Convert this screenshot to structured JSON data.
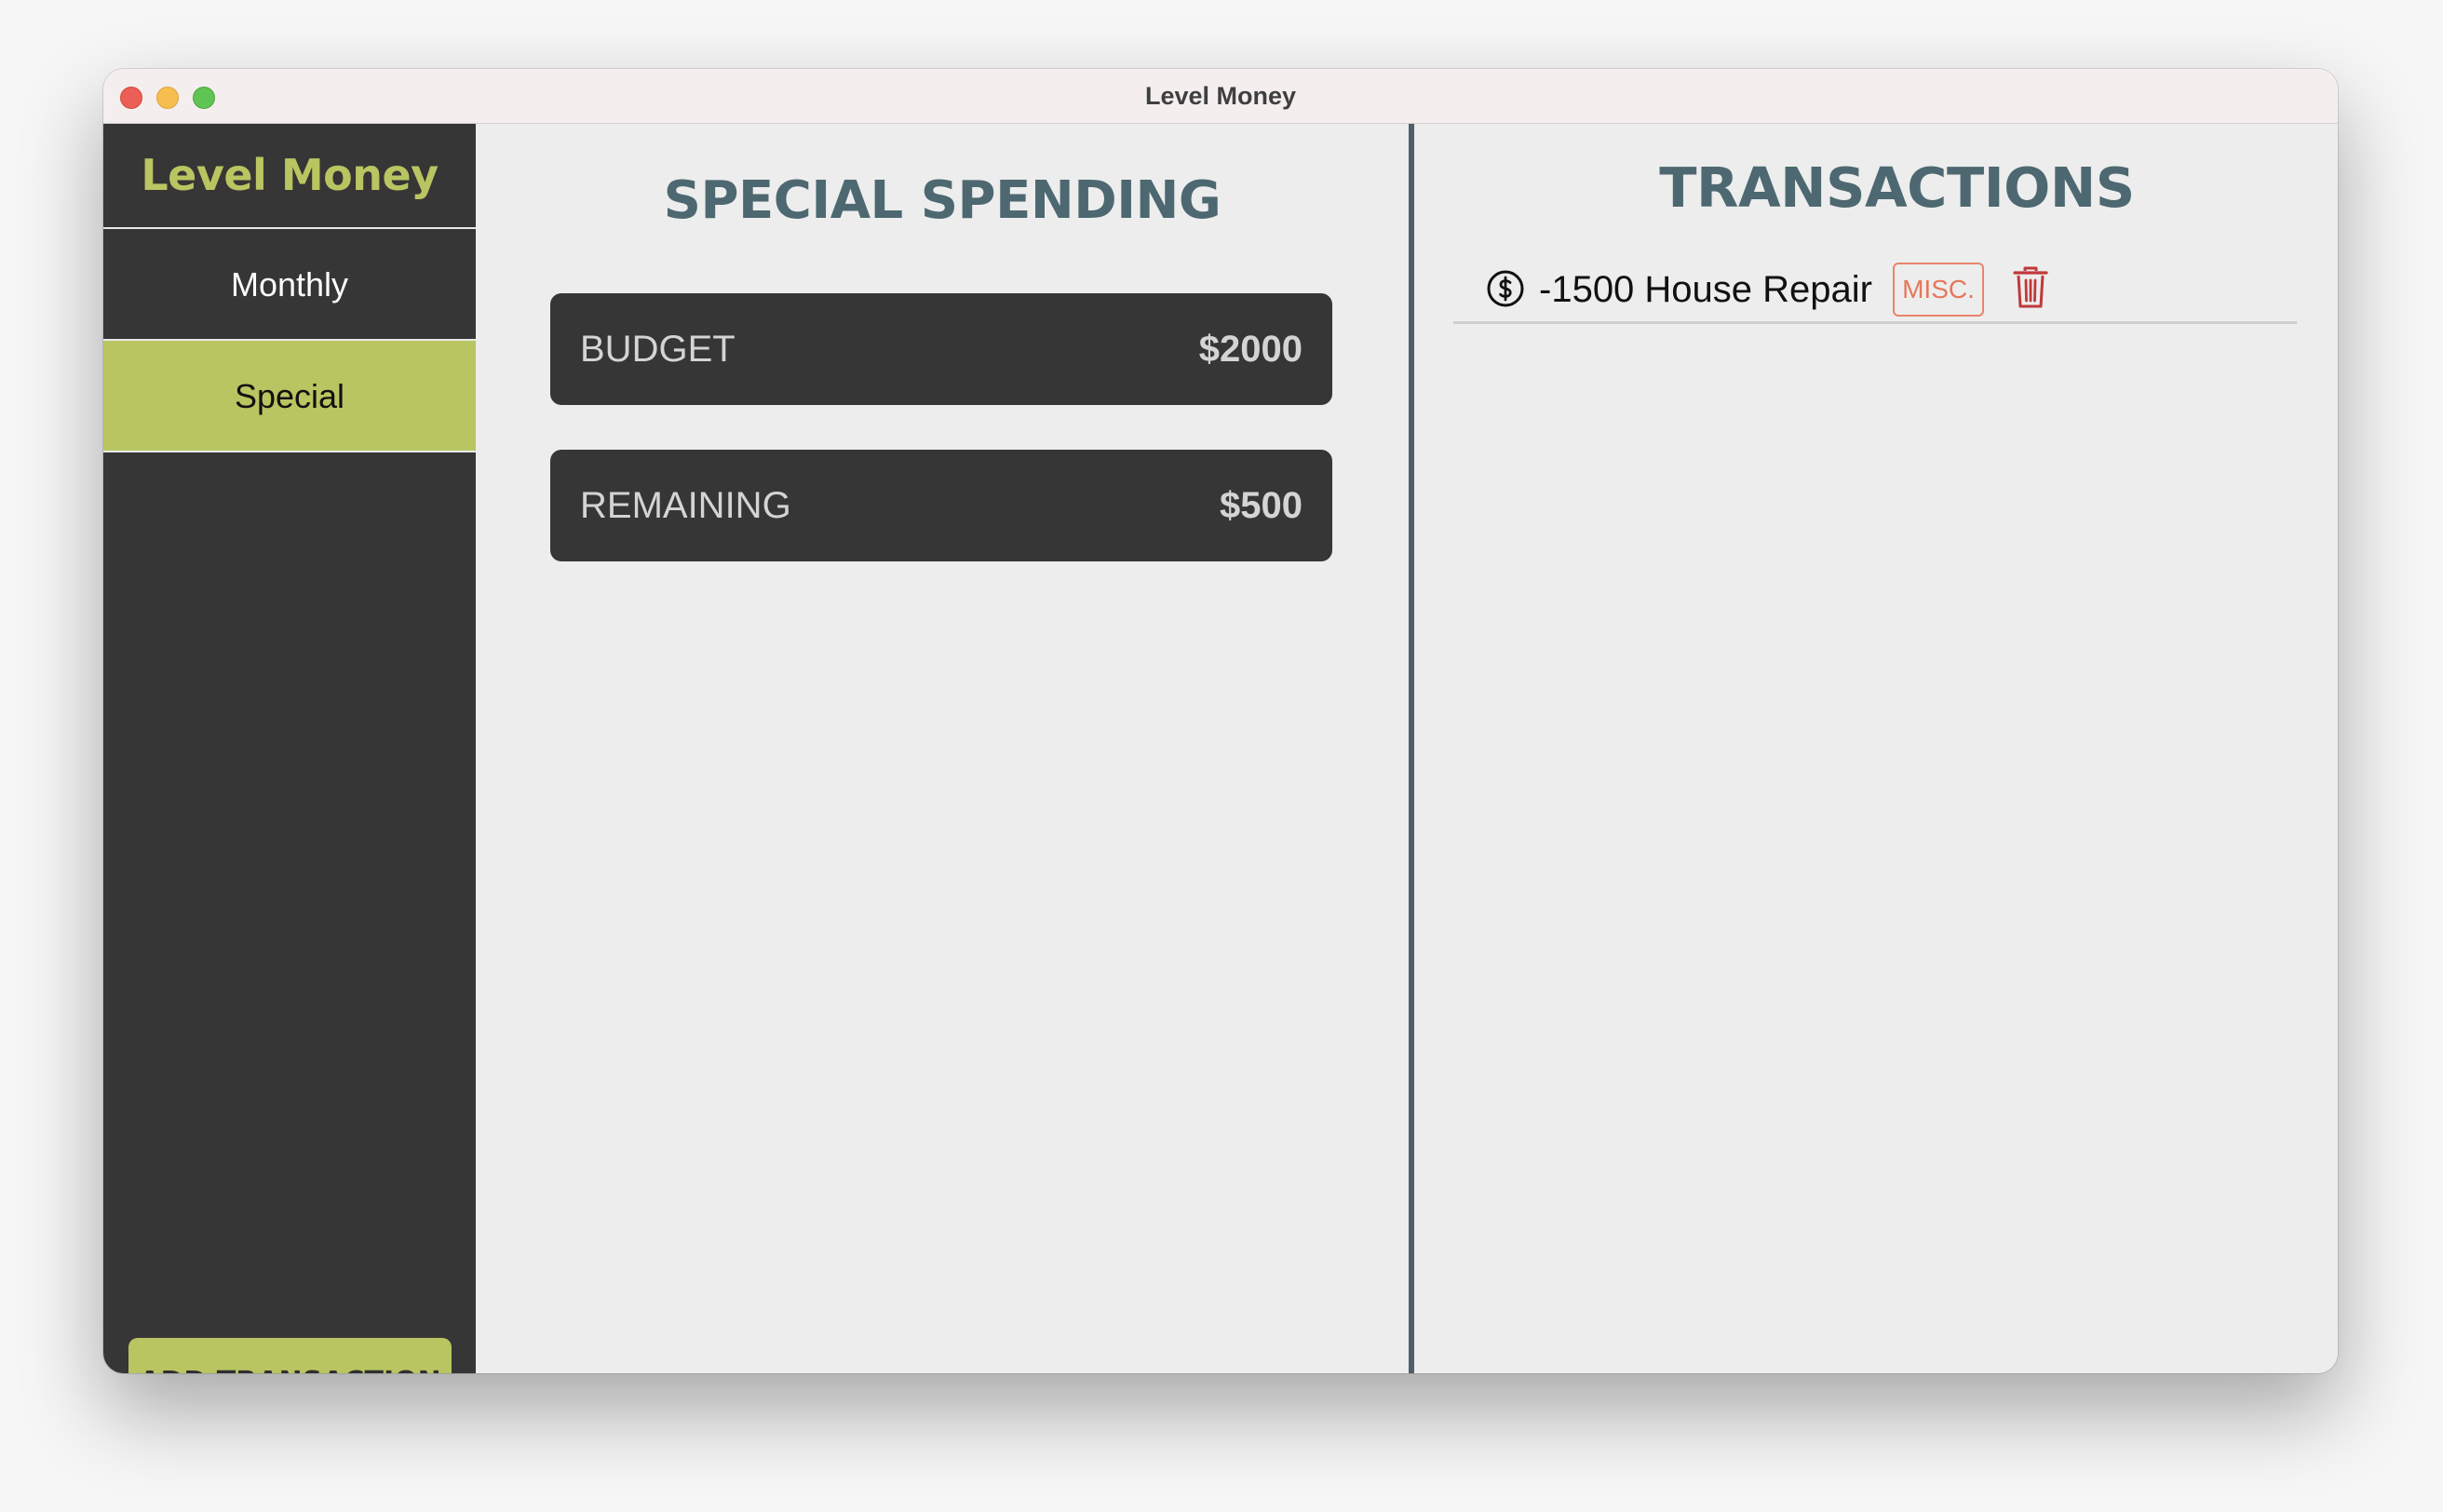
{
  "window": {
    "title": "Level Money"
  },
  "sidebar": {
    "brand": "Level Money",
    "items": [
      {
        "label": "Monthly",
        "active": false
      },
      {
        "label": "Special",
        "active": true
      }
    ],
    "add_button_label": "ADD TRANSACTION"
  },
  "main": {
    "title": "SPECIAL SPENDING",
    "budget": {
      "label": "BUDGET",
      "value": "$2000"
    },
    "remaining": {
      "label": "REMAINING",
      "value": "$500"
    }
  },
  "transactions": {
    "title": "TRANSACTIONS",
    "items": [
      {
        "icon": "dollar-circle-icon",
        "text": "-1500 House Repair",
        "tag": "MISC.",
        "delete_icon": "trash-icon"
      }
    ]
  },
  "colors": {
    "accent": "#b9c561",
    "sidebar_bg": "#363636",
    "heading": "#4d6870",
    "tag": "#e5775a",
    "delete": "#c0393b",
    "content_bg": "#ededed"
  }
}
